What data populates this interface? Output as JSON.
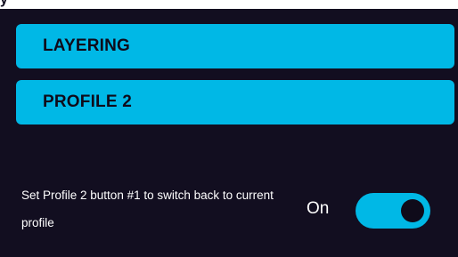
{
  "top_bar": {
    "glyph": "y"
  },
  "sections": [
    {
      "label": "LAYERING"
    },
    {
      "label": "PROFILE 2"
    }
  ],
  "setting": {
    "description": "Set Profile 2 button #1 to switch back to current profile",
    "state_label": "On",
    "enabled": true
  },
  "colors": {
    "background": "#120e20",
    "accent": "#00b8e6",
    "text_dark": "#0f0b1a",
    "text_light": "#ffffff"
  }
}
